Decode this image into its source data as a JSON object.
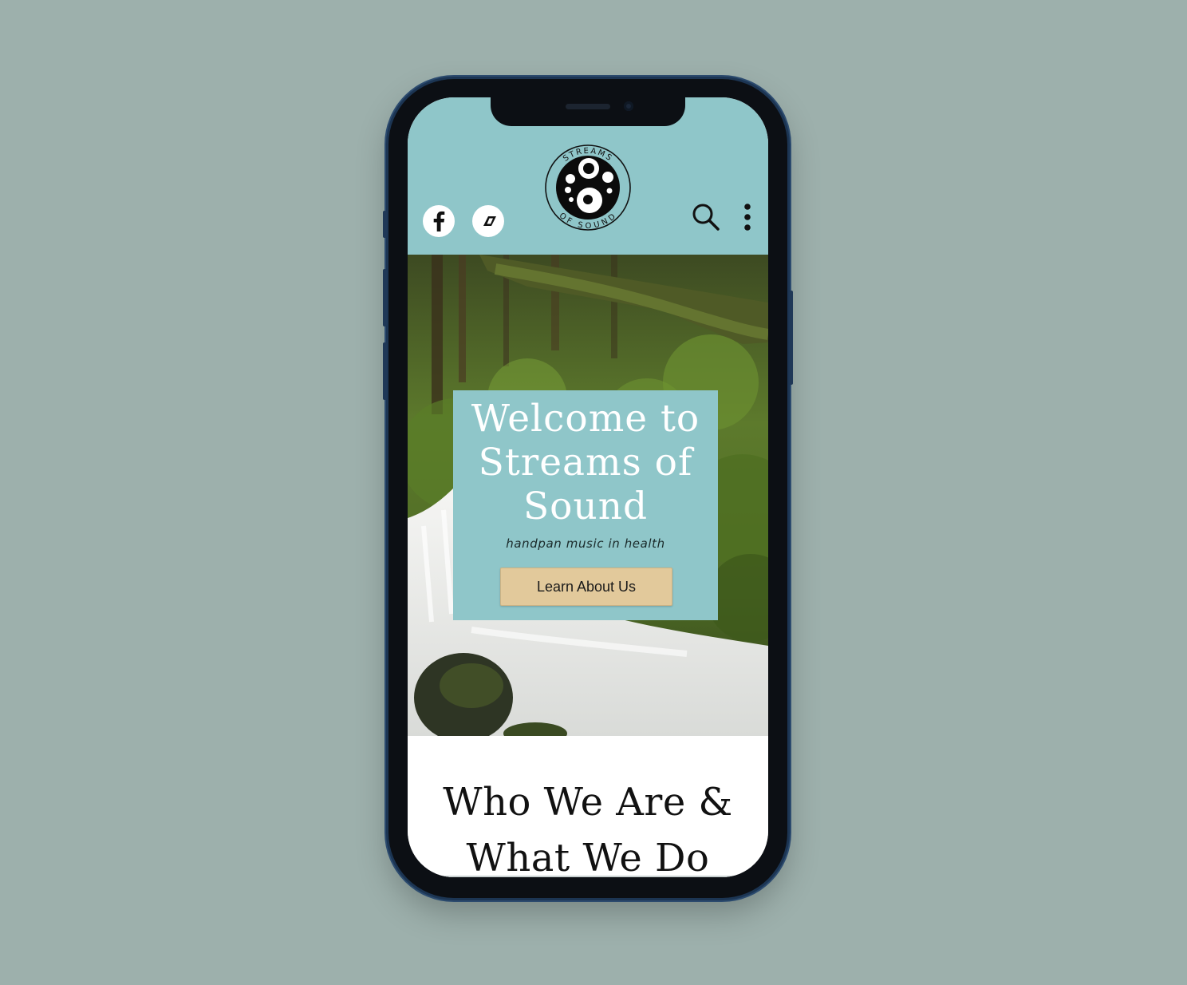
{
  "header": {
    "logo": {
      "top_text": "STREAMS",
      "bottom_text": "OF SOUND",
      "icon": "streams-of-sound-logo"
    },
    "social": [
      {
        "name": "facebook",
        "icon": "facebook-icon"
      },
      {
        "name": "bandcamp",
        "icon": "bandcamp-icon"
      }
    ],
    "search_icon": "search-icon",
    "menu_icon": "kebab-menu-icon"
  },
  "hero": {
    "title": "Welcome to Streams of Sound",
    "subtitle": "handpan music in health",
    "cta_label": "Learn About Us"
  },
  "about": {
    "heading": "Who We Are & What We Do"
  },
  "colors": {
    "page_background": "#9db0ac",
    "brand_teal": "#8fc6c9",
    "cta_tan": "#e2c99b",
    "phone_frame": "#1c3553"
  }
}
